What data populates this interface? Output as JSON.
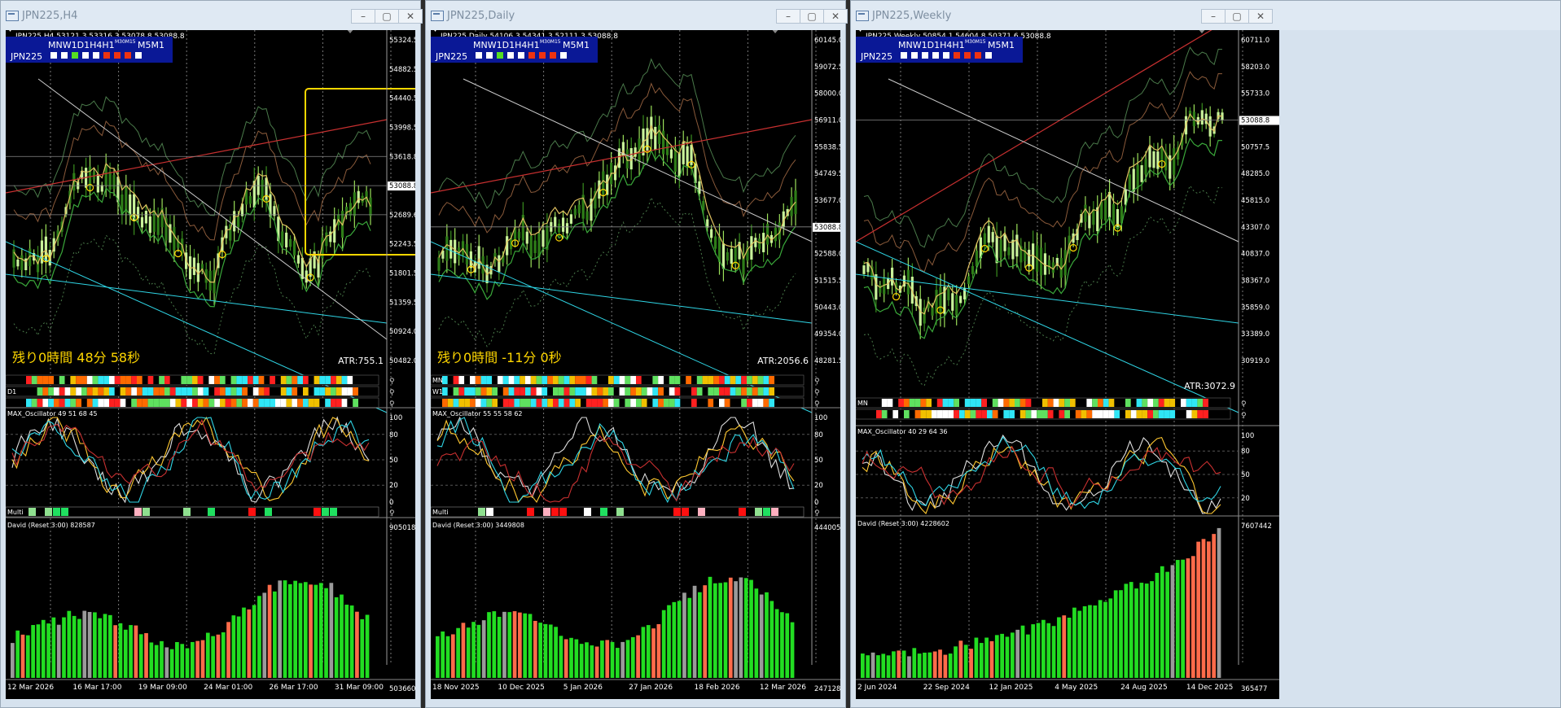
{
  "windows": [
    {
      "title": "JPN225,H4",
      "info": "JPN225,H4  53121.3 53316.3 53078.8 53088.8",
      "tf_labels": "MNW1D1H4H1",
      "tf_sup": "M30M15",
      "tf_labels2": "M5M1",
      "symbol": "JPN225",
      "tf_colors": [
        "#ffffff",
        "#ffffff",
        "#55dd22",
        "#ffffff",
        "#ffffff",
        "#ee3311",
        "#ee3311",
        "#ee3311",
        "#ffffff"
      ],
      "price_ticks": [
        "55324.5",
        "54882.5",
        "54440.5",
        "53998.5",
        "53618.8",
        "53088.8",
        "52689.6",
        "52243.5",
        "51801.5",
        "51359.5",
        "50924.0",
        "50482.0"
      ],
      "timer": "残り0時間 48分 58秒",
      "atr": "ATR:755.1",
      "bar_labels": [
        "",
        "D1",
        ""
      ],
      "osc_label": "MAX_Oscillator 49 51 68 45",
      "osc_ticks": [
        "100",
        "80",
        "50",
        "20",
        "0"
      ],
      "multi_label": "Multi",
      "david_label": "David (Reset 3:00) 828587",
      "david_ticks": [
        "905018",
        "503660"
      ],
      "dates": [
        "12 Mar 2026",
        "16 Mar 17:00",
        "19 Mar 09:00",
        "24 Mar 01:00",
        "26 Mar 17:00",
        "31 Mar 09:00"
      ]
    },
    {
      "title": "JPN225,Daily",
      "info": "JPN225,Daily  54106.3 54341.3 52111.3 53088.8",
      "tf_labels": "MNW1D1H4H1",
      "tf_sup": "M30M15",
      "tf_labels2": "M5M1",
      "symbol": "JPN225",
      "tf_colors": [
        "#ffffff",
        "#ffffff",
        "#55dd22",
        "#ffffff",
        "#ffffff",
        "#ee3311",
        "#ee3311",
        "#ee3311",
        "#ffffff"
      ],
      "price_ticks": [
        "60145.0",
        "59072.5",
        "58000.0",
        "56911.0",
        "55838.5",
        "54749.5",
        "53677.0",
        "53088.8",
        "52588.0",
        "51515.5",
        "50443.0",
        "49354.0",
        "48281.5"
      ],
      "timer": "残り0時間 -11分 0秒",
      "atr": "ATR:2056.6",
      "bar_labels": [
        "MN",
        "W1",
        ""
      ],
      "osc_label": "MAX_Oscillator 55 55 58 62",
      "osc_ticks": [
        "100",
        "80",
        "50",
        "20",
        "0"
      ],
      "multi_label": "Multi",
      "david_label": "David (Reset 3:00) 3449808",
      "david_ticks": [
        "4440059",
        "2471284"
      ],
      "dates": [
        "18 Nov 2025",
        "10 Dec 2025",
        "5 Jan 2026",
        "27 Jan 2026",
        "18 Feb 2026",
        "12 Mar 2026"
      ]
    },
    {
      "title": "JPN225,Weekly",
      "info": "JPN225,Weekly  50854.1 54604.8 50371.6 53088.8",
      "tf_labels": "MNW1D1H4H1",
      "tf_sup": "M30M15",
      "tf_labels2": "M5M1",
      "symbol": "JPN225",
      "tf_colors": [
        "#ffffff",
        "#ffffff",
        "#ffffff",
        "#ffffff",
        "#ffffff",
        "#ee3311",
        "#ee3311",
        "#ee3311",
        "#ffffff"
      ],
      "price_ticks": [
        "60711.0",
        "58203.0",
        "55733.0",
        "53088.8",
        "50757.5",
        "48285.0",
        "45815.0",
        "43307.0",
        "40837.0",
        "38367.0",
        "35859.0",
        "33389.0",
        "30919.0"
      ],
      "timer": "",
      "atr": "ATR:3072.9",
      "bar_labels": [
        "MN",
        "",
        ""
      ],
      "osc_label": "MAX_Oscillator 40 29 64 36",
      "osc_ticks": [
        "100",
        "80",
        "50",
        "20"
      ],
      "multi_label": "",
      "david_label": "David (Reset 3:00) 4228602",
      "david_ticks": [
        "7607442",
        "365477"
      ],
      "dates": [
        "2 Jun 2024",
        "22 Sep 2024",
        "12 Jan 2025",
        "4 May 2025",
        "24 Aug 2025",
        "14 Dec 2025"
      ]
    }
  ],
  "colors": {
    "accent_yellow": "#ffd700",
    "panel_blue": "#0a1896",
    "bull": "#7bd83b",
    "bear": "#ff6b4a",
    "cyan": "#2fd6e6"
  }
}
